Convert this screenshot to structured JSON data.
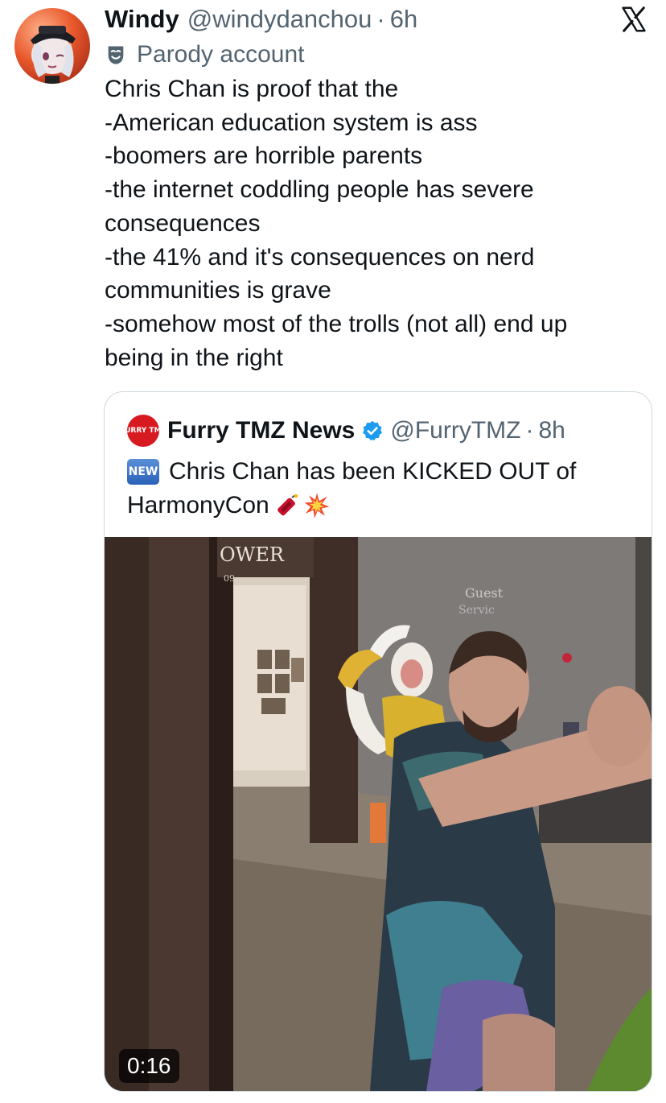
{
  "tweet": {
    "display_name": "Windy",
    "handle": "@windydanchou",
    "separator": "·",
    "time": "6h",
    "parody_label": "Parody account",
    "text_lines": [
      "Chris Chan is proof that the",
      "-American education system is ass",
      "-boomers are horrible parents",
      "-the internet coddling people has severe",
      "consequences",
      "-the 41% and it's consequences on nerd",
      "communities is grave",
      "-somehow most of the trolls (not all) end up",
      "being in the right"
    ]
  },
  "quote": {
    "avatar_text": "FURRY TMZ",
    "display_name": "Furry TMZ News",
    "handle": "@FurryTMZ",
    "separator": "·",
    "time": "8h",
    "new_badge": "NEW",
    "text_line_1": "Chris Chan has been KICKED OUT of",
    "text_line_2": "HarmonyCon",
    "emojis": [
      "firecracker-icon",
      "collision-icon"
    ],
    "video": {
      "duration": "0:16",
      "sign_text": "OWER",
      "sign_sub": "09",
      "guest_services": "Guest Services"
    }
  },
  "icons": {
    "platform_logo": "x-logo-icon",
    "parody_icon": "mask-icon",
    "verified_icon": "verified-badge-icon"
  },
  "colors": {
    "text": "#0f1419",
    "secondary": "#536471",
    "verified": "#1d9bf0",
    "border": "#cfd9de"
  }
}
